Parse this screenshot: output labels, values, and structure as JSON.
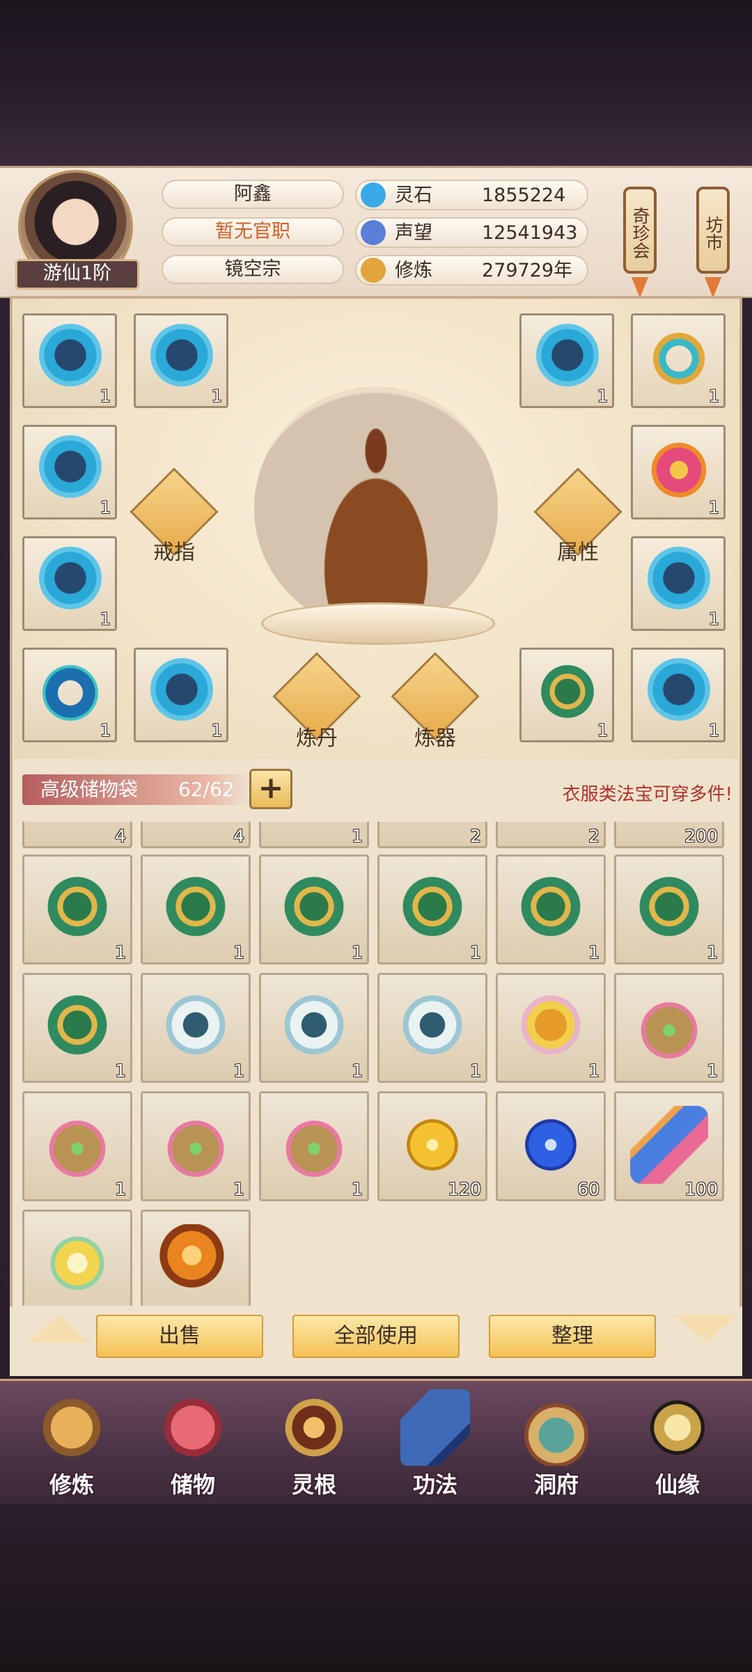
{
  "player": {
    "name": "阿鑫",
    "title": "暂无官职",
    "sect": "镜空宗",
    "rank": "游仙1阶"
  },
  "resources": [
    {
      "label": "灵石",
      "value": "1855224",
      "icon": "spirit-stone-icon",
      "color": "#3aa9e8"
    },
    {
      "label": "声望",
      "value": "12541943",
      "icon": "reputation-icon",
      "color": "#5a7fd8"
    },
    {
      "label": "修炼",
      "value": "279729年",
      "icon": "meditation-icon",
      "color": "#e2a43c"
    }
  ],
  "side_buttons": {
    "treasure_fair": "奇珍会",
    "market": "坊市"
  },
  "equipment": {
    "left": [
      {
        "icon": "robe",
        "count": "1"
      },
      {
        "icon": "robe",
        "count": "1"
      },
      {
        "icon": "robe",
        "count": "1"
      },
      {
        "icon": "robe",
        "count": "1"
      },
      {
        "icon": "ring-blue",
        "count": "1"
      },
      {
        "icon": "robe",
        "count": "1"
      }
    ],
    "right": [
      {
        "icon": "robe",
        "count": "1"
      },
      {
        "icon": "ring-gold",
        "count": "1"
      },
      {
        "icon": "ring-red",
        "count": "1"
      },
      {
        "icon": "robe",
        "count": "1"
      },
      {
        "icon": "armor-green",
        "count": "1"
      },
      {
        "icon": "robe",
        "count": "1"
      }
    ],
    "buttons": {
      "ring": "戒指",
      "attributes": "属性",
      "alchemy": "炼丹",
      "forging": "炼器"
    }
  },
  "storage": {
    "name": "高级储物袋",
    "count": "62/62",
    "add": "+",
    "tip": "衣服类法宝可穿多件!"
  },
  "inventory": {
    "top_row_counts": [
      "4",
      "4",
      "1",
      "2",
      "2",
      "200"
    ],
    "rows": [
      [
        {
          "icon": "armor-green",
          "count": "1"
        },
        {
          "icon": "armor-green",
          "count": "1"
        },
        {
          "icon": "armor-green",
          "count": "1"
        },
        {
          "icon": "armor-green",
          "count": "1"
        },
        {
          "icon": "armor-green",
          "count": "1"
        },
        {
          "icon": "armor-green",
          "count": "1"
        }
      ],
      [
        {
          "icon": "armor-green",
          "count": "1"
        },
        {
          "icon": "robe-white",
          "count": "1"
        },
        {
          "icon": "robe-white",
          "count": "1"
        },
        {
          "icon": "robe-white",
          "count": "1"
        },
        {
          "icon": "robe-gold",
          "count": "1"
        },
        {
          "icon": "bag",
          "count": "1"
        }
      ],
      [
        {
          "icon": "bag",
          "count": "1"
        },
        {
          "icon": "bag",
          "count": "1"
        },
        {
          "icon": "bag",
          "count": "1"
        },
        {
          "icon": "gem-gold",
          "count": "120"
        },
        {
          "icon": "gem-blue",
          "count": "60"
        },
        {
          "icon": "scroll-item",
          "count": "100"
        }
      ],
      [
        {
          "icon": "cloud",
          "count": ""
        },
        {
          "icon": "orb",
          "count": ""
        }
      ]
    ]
  },
  "actions": {
    "sell": "出售",
    "use_all": "全部使用",
    "sort": "整理"
  },
  "nav": [
    {
      "label": "修炼",
      "icon": "cultivation-icon",
      "color": "#c8862e"
    },
    {
      "label": "储物",
      "icon": "storage-bag-icon",
      "color": "#c8414e"
    },
    {
      "label": "灵根",
      "icon": "spirit-root-icon",
      "color": "#7a3a20"
    },
    {
      "label": "功法",
      "icon": "technique-book-icon",
      "color": "#3f6ab8"
    },
    {
      "label": "洞府",
      "icon": "cave-dwelling-icon",
      "color": "#4a7f78"
    },
    {
      "label": "仙缘",
      "icon": "immortal-fate-icon",
      "color": "#c9a24a"
    }
  ]
}
